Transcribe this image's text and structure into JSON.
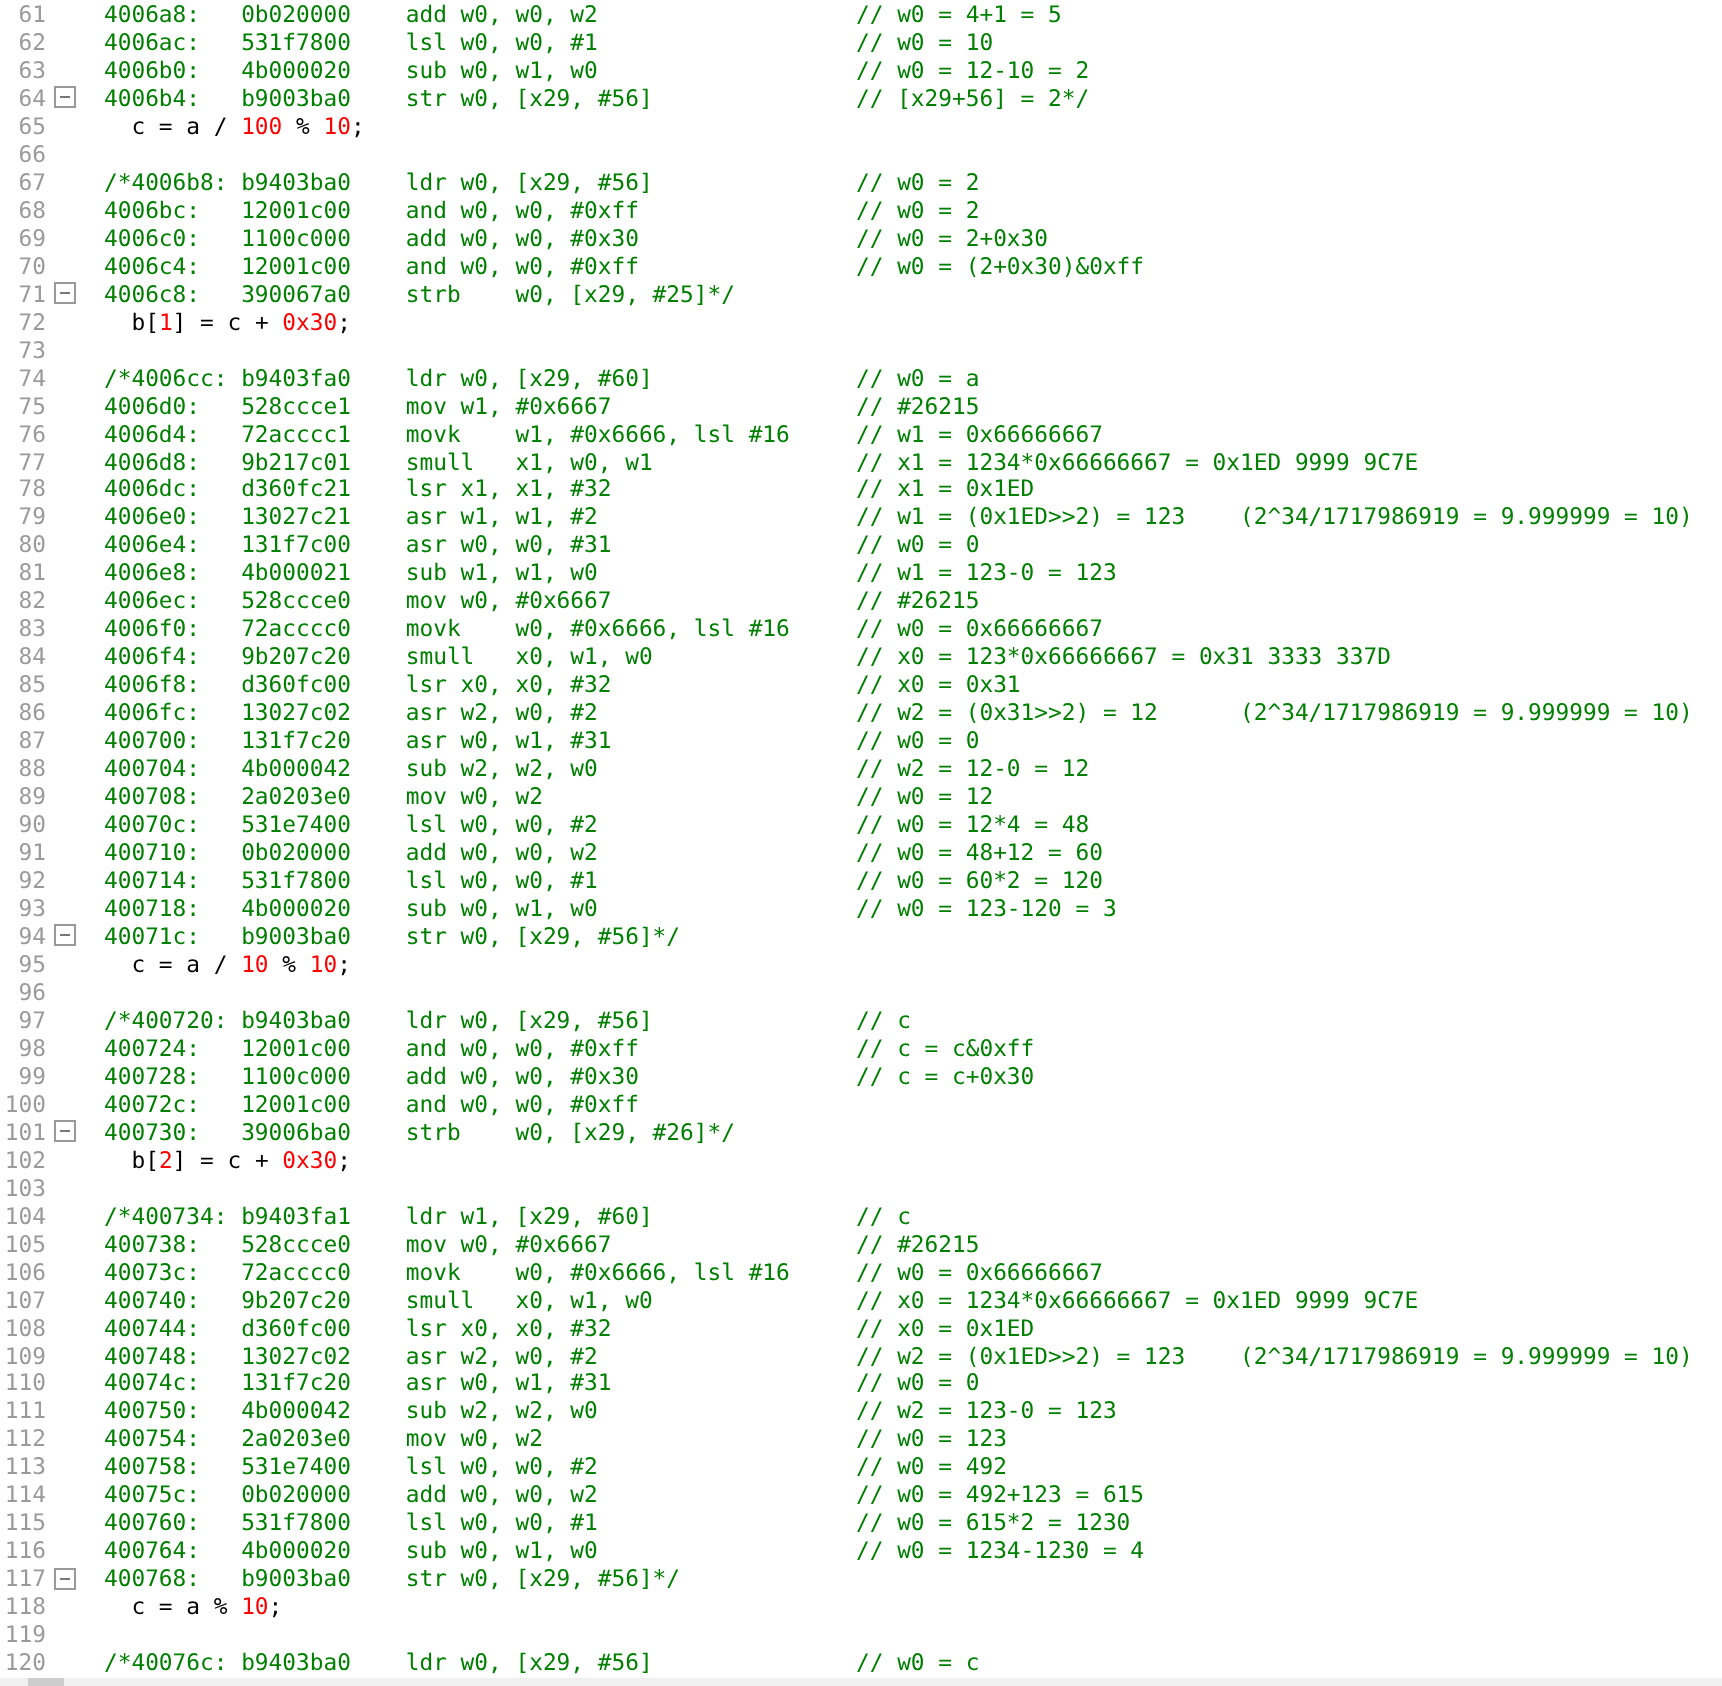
{
  "editor": {
    "lines": [
      {
        "n": "61",
        "kind": "asm",
        "fold": false,
        "code": "4006a8:   0b020000    add w0, w0, w2",
        "comment": "// w0 = 4+1 = 5"
      },
      {
        "n": "62",
        "kind": "asm",
        "fold": false,
        "code": "4006ac:   531f7800    lsl w0, w0, #1",
        "comment": "// w0 = 10"
      },
      {
        "n": "63",
        "kind": "asm",
        "fold": false,
        "code": "4006b0:   4b000020    sub w0, w1, w0",
        "comment": "// w0 = 12-10 = 2"
      },
      {
        "n": "64",
        "kind": "asm",
        "fold": true,
        "code": "4006b4:   b9003ba0    str w0, [x29, #56]",
        "comment": "// [x29+56] = 2*/"
      },
      {
        "n": "65",
        "kind": "src",
        "fold": false,
        "tokens": [
          {
            "text": "  c = a / ",
            "kind": "plain"
          },
          {
            "text": "100",
            "kind": "number"
          },
          {
            "text": " % ",
            "kind": "plain"
          },
          {
            "text": "10",
            "kind": "number"
          },
          {
            "text": ";",
            "kind": "plain"
          }
        ]
      },
      {
        "n": "66",
        "kind": "blank",
        "fold": false
      },
      {
        "n": "67",
        "kind": "asm",
        "fold": false,
        "code": "/*4006b8: b9403ba0    ldr w0, [x29, #56]",
        "comment": "// w0 = 2"
      },
      {
        "n": "68",
        "kind": "asm",
        "fold": false,
        "code": "4006bc:   12001c00    and w0, w0, #0xff",
        "comment": "// w0 = 2"
      },
      {
        "n": "69",
        "kind": "asm",
        "fold": false,
        "code": "4006c0:   1100c000    add w0, w0, #0x30",
        "comment": "// w0 = 2+0x30"
      },
      {
        "n": "70",
        "kind": "asm",
        "fold": false,
        "code": "4006c4:   12001c00    and w0, w0, #0xff",
        "comment": "// w0 = (2+0x30)&0xff"
      },
      {
        "n": "71",
        "kind": "asm",
        "fold": true,
        "code": "4006c8:   390067a0    strb    w0, [x29, #25]*/"
      },
      {
        "n": "72",
        "kind": "src",
        "fold": false,
        "tokens": [
          {
            "text": "  b[",
            "kind": "plain"
          },
          {
            "text": "1",
            "kind": "number"
          },
          {
            "text": "] = c + ",
            "kind": "plain"
          },
          {
            "text": "0x30",
            "kind": "number"
          },
          {
            "text": ";",
            "kind": "plain"
          }
        ]
      },
      {
        "n": "73",
        "kind": "blank",
        "fold": false
      },
      {
        "n": "74",
        "kind": "asm",
        "fold": false,
        "code": "/*4006cc: b9403fa0    ldr w0, [x29, #60]",
        "comment": "// w0 = a"
      },
      {
        "n": "75",
        "kind": "asm",
        "fold": false,
        "code": "4006d0:   528ccce1    mov w1, #0x6667",
        "comment": "// #26215"
      },
      {
        "n": "76",
        "kind": "asm",
        "fold": false,
        "code": "4006d4:   72acccc1    movk    w1, #0x6666, lsl #16",
        "comment": "// w1 = 0x66666667"
      },
      {
        "n": "77",
        "kind": "asm",
        "fold": false,
        "code": "4006d8:   9b217c01    smull   x1, w0, w1",
        "comment": "// x1 = 1234*0x66666667 = 0x1ED 9999 9C7E"
      },
      {
        "n": "78",
        "kind": "asm",
        "fold": false,
        "code": "4006dc:   d360fc21    lsr x1, x1, #32",
        "comment": "// x1 = 0x1ED"
      },
      {
        "n": "79",
        "kind": "asm",
        "fold": false,
        "code": "4006e0:   13027c21    asr w1, w1, #2",
        "comment": "// w1 = (0x1ED>>2) = 123    (2^34/1717986919 = 9.999999 = 10)"
      },
      {
        "n": "80",
        "kind": "asm",
        "fold": false,
        "code": "4006e4:   131f7c00    asr w0, w0, #31",
        "comment": "// w0 = 0"
      },
      {
        "n": "81",
        "kind": "asm",
        "fold": false,
        "code": "4006e8:   4b000021    sub w1, w1, w0",
        "comment": "// w1 = 123-0 = 123"
      },
      {
        "n": "82",
        "kind": "asm",
        "fold": false,
        "code": "4006ec:   528ccce0    mov w0, #0x6667",
        "comment": "// #26215"
      },
      {
        "n": "83",
        "kind": "asm",
        "fold": false,
        "code": "4006f0:   72acccc0    movk    w0, #0x6666, lsl #16",
        "comment": "// w0 = 0x66666667"
      },
      {
        "n": "84",
        "kind": "asm",
        "fold": false,
        "code": "4006f4:   9b207c20    smull   x0, w1, w0",
        "comment": "// x0 = 123*0x66666667 = 0x31 3333 337D"
      },
      {
        "n": "85",
        "kind": "asm",
        "fold": false,
        "code": "4006f8:   d360fc00    lsr x0, x0, #32",
        "comment": "// x0 = 0x31"
      },
      {
        "n": "86",
        "kind": "asm",
        "fold": false,
        "code": "4006fc:   13027c02    asr w2, w0, #2",
        "comment": "// w2 = (0x31>>2) = 12      (2^34/1717986919 = 9.999999 = 10)"
      },
      {
        "n": "87",
        "kind": "asm",
        "fold": false,
        "code": "400700:   131f7c20    asr w0, w1, #31",
        "comment": "// w0 = 0"
      },
      {
        "n": "88",
        "kind": "asm",
        "fold": false,
        "code": "400704:   4b000042    sub w2, w2, w0",
        "comment": "// w2 = 12-0 = 12"
      },
      {
        "n": "89",
        "kind": "asm",
        "fold": false,
        "code": "400708:   2a0203e0    mov w0, w2",
        "comment": "// w0 = 12"
      },
      {
        "n": "90",
        "kind": "asm",
        "fold": false,
        "code": "40070c:   531e7400    lsl w0, w0, #2",
        "comment": "// w0 = 12*4 = 48"
      },
      {
        "n": "91",
        "kind": "asm",
        "fold": false,
        "code": "400710:   0b020000    add w0, w0, w2",
        "comment": "// w0 = 48+12 = 60"
      },
      {
        "n": "92",
        "kind": "asm",
        "fold": false,
        "code": "400714:   531f7800    lsl w0, w0, #1",
        "comment": "// w0 = 60*2 = 120"
      },
      {
        "n": "93",
        "kind": "asm",
        "fold": false,
        "code": "400718:   4b000020    sub w0, w1, w0",
        "comment": "// w0 = 123-120 = 3"
      },
      {
        "n": "94",
        "kind": "asm",
        "fold": true,
        "code": "40071c:   b9003ba0    str w0, [x29, #56]*/"
      },
      {
        "n": "95",
        "kind": "src",
        "fold": false,
        "tokens": [
          {
            "text": "  c = a / ",
            "kind": "plain"
          },
          {
            "text": "10",
            "kind": "number"
          },
          {
            "text": " % ",
            "kind": "plain"
          },
          {
            "text": "10",
            "kind": "number"
          },
          {
            "text": ";",
            "kind": "plain"
          }
        ]
      },
      {
        "n": "96",
        "kind": "blank",
        "fold": false
      },
      {
        "n": "97",
        "kind": "asm",
        "fold": false,
        "code": "/*400720: b9403ba0    ldr w0, [x29, #56]",
        "comment": "// c"
      },
      {
        "n": "98",
        "kind": "asm",
        "fold": false,
        "code": "400724:   12001c00    and w0, w0, #0xff",
        "comment": "// c = c&0xff"
      },
      {
        "n": "99",
        "kind": "asm",
        "fold": false,
        "code": "400728:   1100c000    add w0, w0, #0x30",
        "comment": "// c = c+0x30"
      },
      {
        "n": "100",
        "kind": "asm",
        "fold": false,
        "code": "40072c:   12001c00    and w0, w0, #0xff"
      },
      {
        "n": "101",
        "kind": "asm",
        "fold": true,
        "code": "400730:   39006ba0    strb    w0, [x29, #26]*/"
      },
      {
        "n": "102",
        "kind": "src",
        "fold": false,
        "tokens": [
          {
            "text": "  b[",
            "kind": "plain"
          },
          {
            "text": "2",
            "kind": "number"
          },
          {
            "text": "] = c + ",
            "kind": "plain"
          },
          {
            "text": "0x30",
            "kind": "number"
          },
          {
            "text": ";",
            "kind": "plain"
          }
        ]
      },
      {
        "n": "103",
        "kind": "blank",
        "fold": false
      },
      {
        "n": "104",
        "kind": "asm",
        "fold": false,
        "code": "/*400734: b9403fa1    ldr w1, [x29, #60]",
        "comment": "// c"
      },
      {
        "n": "105",
        "kind": "asm",
        "fold": false,
        "code": "400738:   528ccce0    mov w0, #0x6667",
        "comment": "// #26215"
      },
      {
        "n": "106",
        "kind": "asm",
        "fold": false,
        "code": "40073c:   72acccc0    movk    w0, #0x6666, lsl #16",
        "comment": "// w0 = 0x66666667"
      },
      {
        "n": "107",
        "kind": "asm",
        "fold": false,
        "code": "400740:   9b207c20    smull   x0, w1, w0",
        "comment": "// x0 = 1234*0x66666667 = 0x1ED 9999 9C7E"
      },
      {
        "n": "108",
        "kind": "asm",
        "fold": false,
        "code": "400744:   d360fc00    lsr x0, x0, #32",
        "comment": "// x0 = 0x1ED"
      },
      {
        "n": "109",
        "kind": "asm",
        "fold": false,
        "code": "400748:   13027c02    asr w2, w0, #2",
        "comment": "// w2 = (0x1ED>>2) = 123    (2^34/1717986919 = 9.999999 = 10)"
      },
      {
        "n": "110",
        "kind": "asm",
        "fold": false,
        "code": "40074c:   131f7c20    asr w0, w1, #31",
        "comment": "// w0 = 0"
      },
      {
        "n": "111",
        "kind": "asm",
        "fold": false,
        "code": "400750:   4b000042    sub w2, w2, w0",
        "comment": "// w2 = 123-0 = 123"
      },
      {
        "n": "112",
        "kind": "asm",
        "fold": false,
        "code": "400754:   2a0203e0    mov w0, w2",
        "comment": "// w0 = 123"
      },
      {
        "n": "113",
        "kind": "asm",
        "fold": false,
        "code": "400758:   531e7400    lsl w0, w0, #2",
        "comment": "// w0 = 492"
      },
      {
        "n": "114",
        "kind": "asm",
        "fold": false,
        "code": "40075c:   0b020000    add w0, w0, w2",
        "comment": "// w0 = 492+123 = 615"
      },
      {
        "n": "115",
        "kind": "asm",
        "fold": false,
        "code": "400760:   531f7800    lsl w0, w0, #1",
        "comment": "// w0 = 615*2 = 1230"
      },
      {
        "n": "116",
        "kind": "asm",
        "fold": false,
        "code": "400764:   4b000020    sub w0, w1, w0",
        "comment": "// w0 = 1234-1230 = 4"
      },
      {
        "n": "117",
        "kind": "asm",
        "fold": true,
        "code": "400768:   b9003ba0    str w0, [x29, #56]*/"
      },
      {
        "n": "118",
        "kind": "src",
        "fold": false,
        "tokens": [
          {
            "text": "  c = a % ",
            "kind": "plain"
          },
          {
            "text": "10",
            "kind": "number"
          },
          {
            "text": ";",
            "kind": "plain"
          }
        ]
      },
      {
        "n": "119",
        "kind": "blank",
        "fold": false
      },
      {
        "n": "120",
        "kind": "asm",
        "fold": false,
        "code": "/*40076c: b9403ba0    ldr w0, [x29, #56]",
        "comment": "// w0 = c"
      }
    ]
  }
}
